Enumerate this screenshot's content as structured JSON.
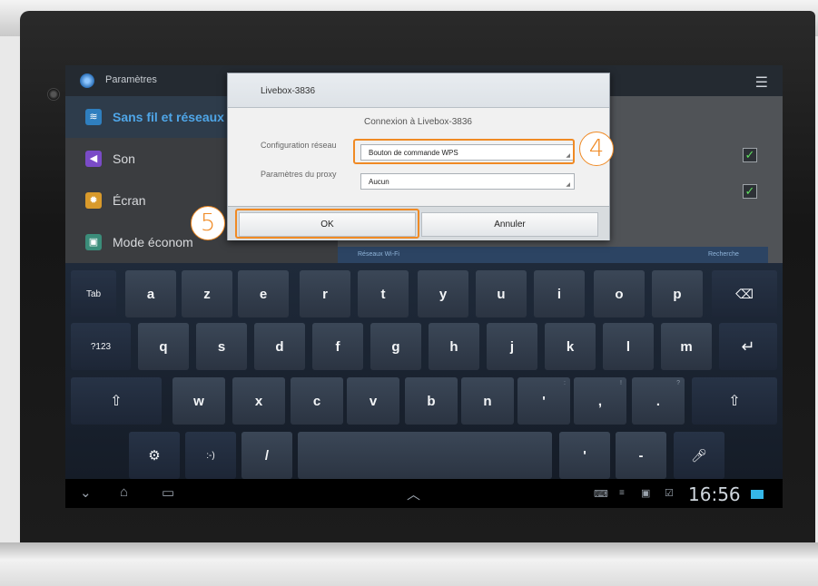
{
  "settings": {
    "title": "Paramètres",
    "menu_icon": "menu-icon",
    "items": [
      {
        "label": "Sans fil et réseaux",
        "icon": "wifi-icon",
        "color": "#2f7fbf"
      },
      {
        "label": "Son",
        "icon": "speaker-icon",
        "color": "#7a4bc7"
      },
      {
        "label": "Écran",
        "icon": "brightness-icon",
        "color": "#d99a2b"
      },
      {
        "label": "Mode économ",
        "icon": "battery-icon",
        "color": "#3b8d7a"
      }
    ],
    "wifi_section": "Réseaux Wi-Fi",
    "search": "Recherche"
  },
  "dialog": {
    "title": "Livebox-3836",
    "subtitle": "Connexion à Livebox-3836",
    "fields": [
      {
        "label": "Configuration réseau",
        "value": "Bouton de commande WPS"
      },
      {
        "label": "Paramètres du proxy",
        "value": "Aucun"
      }
    ],
    "ok_label": "OK",
    "cancel_label": "Annuler"
  },
  "callouts": {
    "step4": "4",
    "step5": "5"
  },
  "keyboard": {
    "row1": [
      "Tab",
      "a",
      "z",
      "e",
      "r",
      "t",
      "y",
      "u",
      "i",
      "o",
      "p"
    ],
    "row2": [
      "?123",
      "q",
      "s",
      "d",
      "f",
      "g",
      "h",
      "j",
      "k",
      "l",
      "m"
    ],
    "row3": [
      "w",
      "x",
      "c",
      "v",
      "b",
      "n",
      "'",
      ",",
      "."
    ],
    "row4": [
      ":-)",
      "/",
      "'",
      "-"
    ]
  },
  "status": {
    "time": "16:56"
  },
  "colors": {
    "accent": "#f08a24",
    "link": "#4fa6e8",
    "keyboard": "#1f2a3a"
  }
}
